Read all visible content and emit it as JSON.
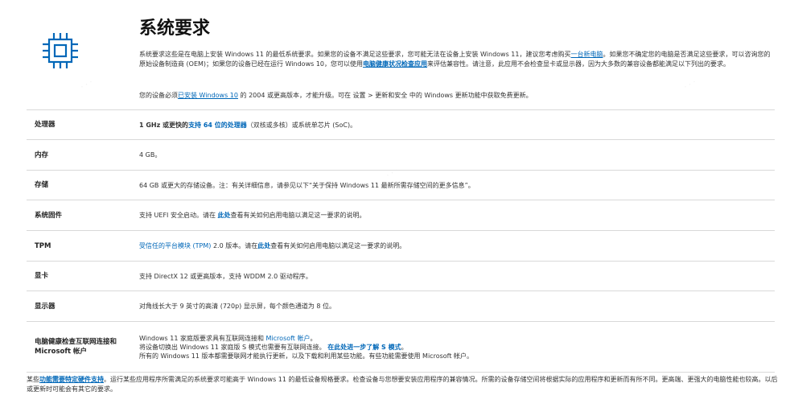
{
  "page": {
    "title": "系统要求",
    "icon": "processor-chip-icon",
    "accent_color": "#0067b8"
  },
  "intro": {
    "p1_a": "系统要求这些是在电脑上安装 Windows 11 的最低系统要求。如果您的设备不满足这些要求，您可能无法在设备上安装 Windows 11，建议您考虑购买",
    "p1_link1": "一台新电脑",
    "p1_b": "。如果您不确定您的电脑是否满足这些要求，可以咨询您的原始设备制造商 (OEM)；如果您的设备已经在运行 Windows 10，您可以使用",
    "p1_link2": "电脑健康状况检查应用",
    "p1_c": "来评估兼容性。请注意，此应用不会检查显卡或显示器，因为大多数的兼容设备都能满足以下列出的要求。",
    "p2_a": "您的设备必须",
    "p2_link": "已安装 Windows 10",
    "p2_b": "的 2004 或更高版本，才能升级。可在 设置 > 更新和安全 中的 Windows 更新功能中获取免费更新。"
  },
  "rows": [
    {
      "label": "处理器",
      "v_a": "1 GHz 或更快的",
      "v_link": "支持 64 位的处理器",
      "v_b": "（双核或多核）或系统单芯片 (SoC)。"
    },
    {
      "label": "内存",
      "v": "4 GB。"
    },
    {
      "label": "存储",
      "v": "64 GB 或更大的存储设备。注：有关详细信息，请参见以下“关于保持 Windows 11 最新所需存储空间的更多信息”。"
    },
    {
      "label": "系统固件",
      "v_a": "支持 UEFI 安全启动。请在",
      "v_link": "此处",
      "v_b": "查看有关如何启用电脑以满足这一要求的说明。"
    },
    {
      "label": "TPM",
      "v_link0": "受信任的平台模块 (TPM)",
      "v_a": "2.0 版本。请在",
      "v_link": "此处",
      "v_b": "查看有关如何启用电脑以满足这一要求的说明。"
    },
    {
      "label": "显卡",
      "v": "支持 DirectX 12 或更高版本，支持 WDDM 2.0 驱动程序。"
    },
    {
      "label": "显示器",
      "v": "对角线长大于 9 英寸的高清 (720p) 显示屏，每个颜色通道为 8 位。"
    },
    {
      "label_1": "电脑健康检查互联网连接和",
      "label_2": "Microsoft 帐户",
      "l1_a": "Windows 11 家庭版要求具有互联网连接和",
      "l1_link": "Microsoft 帐户",
      "l1_b": "。",
      "l2_a": "将设备切换出 Windows 11 家庭版 S 模式也需要有互联网连接。",
      "l2_link": "在此处进一步了解 S 模式",
      "l2_b": "。",
      "l3": "所有的 Windows 11 版本都需要联网才能执行更新，以及下载和利用某些功能。有些功能需要使用 Microsoft 帐户。"
    }
  ],
  "footer": {
    "a": "某些",
    "link": "功能需要特定硬件支持",
    "b": "。运行某些应用程序所需满足的系统要求可能高于 Windows 11 的最低设备规格要求。检查设备与您想要安装应用程序的兼容情况。所需的设备存储空间将根据实际的应用程序和更新而有所不同。更高端、更强大的电脑性能也较高。以后或更新时可能会有其它的要求。"
  }
}
